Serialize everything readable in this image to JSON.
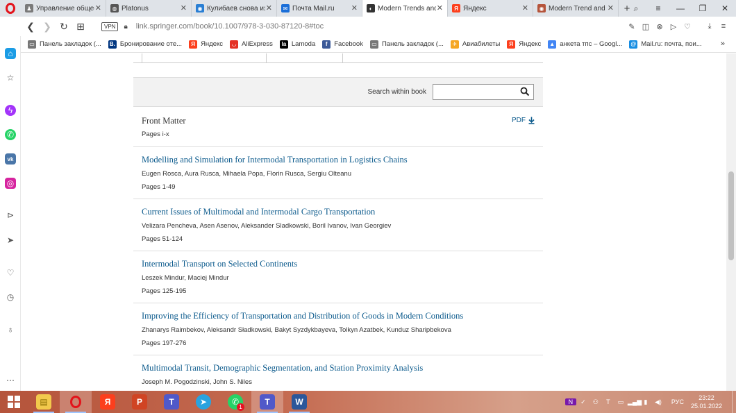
{
  "browser": {
    "tabs": [
      {
        "label": "Управление общеоб",
        "icon_color": "#7a7a7a",
        "icon_text": "♟"
      },
      {
        "label": "Platonus",
        "icon_color": "#555555",
        "icon_text": "◍"
      },
      {
        "label": "Кулибаев снова из",
        "icon_color": "#2a7fd4",
        "icon_text": "◉"
      },
      {
        "label": "Почта Mail.ru",
        "icon_color": "#1a6ed8",
        "icon_text": "✉"
      },
      {
        "label": "Modern Trends and",
        "icon_color": "#333333",
        "icon_text": "◐",
        "active": true
      },
      {
        "label": "Яндекс",
        "icon_color": "#fc3f1d",
        "icon_text": "Я"
      },
      {
        "label": "Modern Trend and",
        "icon_color": "#b5543b",
        "icon_text": "◉"
      }
    ],
    "url_host": "link.springer.com",
    "url_path": "/book/10.1007/978-3-030-87120-8#toc",
    "vpn_label": "VPN",
    "bookmarks": [
      {
        "label": "Панель закладок (...",
        "icon_color": "#777777",
        "icon_text": "▭"
      },
      {
        "label": "Бронирование оте...",
        "icon_color": "#003580",
        "icon_text": "B."
      },
      {
        "label": "Яндекс",
        "icon_color": "#fc3f1d",
        "icon_text": "Я"
      },
      {
        "label": "AliExpress",
        "icon_color": "#e43225",
        "icon_text": "◡"
      },
      {
        "label": "Lamoda",
        "icon_color": "#000000",
        "icon_text": "la"
      },
      {
        "label": "Facebook",
        "icon_color": "#3b5998",
        "icon_text": "f"
      },
      {
        "label": "Панель закладок (...",
        "icon_color": "#777777",
        "icon_text": "▭"
      },
      {
        "label": "Авиабилеты",
        "icon_color": "#f5a623",
        "icon_text": "✈"
      },
      {
        "label": "Яндекс",
        "icon_color": "#fc3f1d",
        "icon_text": "Я"
      },
      {
        "label": "анкета тпс – Googl...",
        "icon_color": "#4285f4",
        "icon_text": "▲"
      },
      {
        "label": "Mail.ru: почта, пои...",
        "icon_color": "#168de2",
        "icon_text": "@"
      }
    ]
  },
  "page": {
    "search_label": "Search within book",
    "search_value": "",
    "front_matter": {
      "title": "Front Matter",
      "pages": "Pages i-x",
      "pdf_label": "PDF"
    },
    "chapters": [
      {
        "title": "Modelling and Simulation for Intermodal Transportation in Logistics Chains",
        "authors": "Eugen Rosca, Aura Rusca, Mihaela Popa, Florin Rusca, Sergiu Olteanu",
        "pages": "Pages 1-49"
      },
      {
        "title": "Current Issues of Multimodal and Intermodal Cargo Transportation",
        "authors": "Velizara Pencheva, Asen Asenov, Aleksander Sladkowski, Boril Ivanov, Ivan Georgiev",
        "pages": "Pages 51-124"
      },
      {
        "title": "Intermodal Transport on Selected Continents",
        "authors": "Leszek Mindur, Maciej Mindur",
        "pages": "Pages 125-195"
      },
      {
        "title": "Improving the Efficiency of Transportation and Distribution of Goods in Modern Conditions",
        "authors": "Zhanarys Raimbekov, Aleksandr Sładkowski, Bakyt Syzdykbayeva, Tolkyn Azatbek, Kunduz Sharipbekova",
        "pages": "Pages 197-276"
      },
      {
        "title": "Multimodal Transit, Demographic Segmentation, and Station Proximity Analysis",
        "authors": "Joseph M. Pogodzinski, John S. Niles",
        "pages": ""
      }
    ]
  },
  "taskbar": {
    "lang": "РУС",
    "time": "23:22",
    "date": "25.01.2022",
    "badge_count": "1"
  }
}
